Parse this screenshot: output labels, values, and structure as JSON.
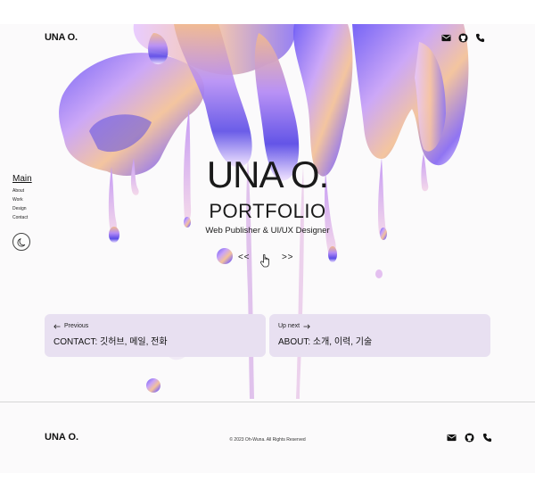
{
  "header": {
    "logo": "UNA O.",
    "icons": [
      "mail-icon",
      "github-icon",
      "phone-icon"
    ]
  },
  "sidenav": {
    "main": "Main",
    "items": [
      "About",
      "Work",
      "Design",
      "Contact"
    ],
    "theme_icon": "moon-icon"
  },
  "hero": {
    "title": "UNA O.",
    "subtitle": "PORTFOLIO",
    "role": "Web Publisher & UI/UX Designer",
    "prev_arrows": "< <",
    "next_arrows": "> >"
  },
  "cards": {
    "previous": {
      "label": "Previous",
      "title": "CONTACT: 깃허브, 메일, 전화"
    },
    "next": {
      "label": "Up next",
      "title": "ABOUT: 소개, 이력, 기술"
    }
  },
  "footer": {
    "logo": "UNA O.",
    "copyright": "© 2023 Oh-Wuna. All Rights Reserved"
  },
  "colors": {
    "background": "#fbfafb",
    "card": "#e8e0f1",
    "accent_purple": "#7b6cf0",
    "accent_orange": "#e8a27a",
    "text": "#1a1a1a"
  }
}
